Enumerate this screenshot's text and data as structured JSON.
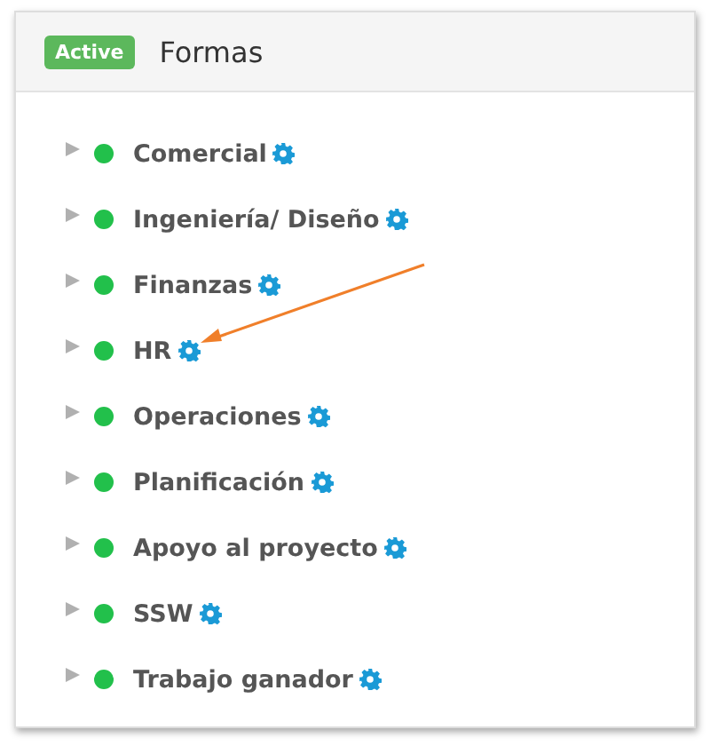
{
  "header": {
    "badge": "Active",
    "title": "Formas"
  },
  "items": [
    {
      "label": "Comercial",
      "expanded": false
    },
    {
      "label": "Ingeniería/ Diseño",
      "expanded": false
    },
    {
      "label": "Finanzas",
      "expanded": false
    },
    {
      "label": "HR",
      "expanded": false
    },
    {
      "label": "Operaciones",
      "expanded": false
    },
    {
      "label": "Planificación",
      "expanded": false
    },
    {
      "label": "Apoyo al proyecto",
      "expanded": false
    },
    {
      "label": "SSW",
      "expanded": false
    },
    {
      "label": "Trabajo ganador",
      "expanded": false
    }
  ]
}
